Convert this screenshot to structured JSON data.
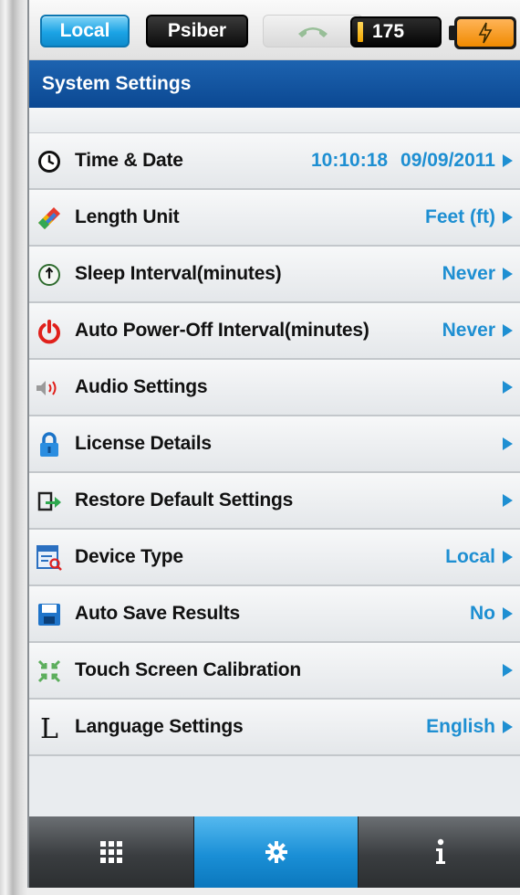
{
  "status_bar": {
    "mode_local": "Local",
    "mode_psiber": "Psiber",
    "count": "175"
  },
  "header": {
    "title": "System Settings"
  },
  "settings": [
    {
      "label": "Time & Date",
      "time": "10:10:18",
      "date": "09/09/2011",
      "icon": "clock-icon"
    },
    {
      "label": "Length Unit",
      "value": "Feet (ft)",
      "icon": "ruler-icon"
    },
    {
      "label": "Sleep Interval(minutes)",
      "value": "Never",
      "icon": "sleep-icon"
    },
    {
      "label": "Auto Power-Off Interval(minutes)",
      "value": "Never",
      "icon": "power-icon"
    },
    {
      "label": "Audio Settings",
      "value": "",
      "icon": "speaker-icon"
    },
    {
      "label": "License Details",
      "value": "",
      "icon": "lock-icon"
    },
    {
      "label": "Restore Default Settings",
      "value": "",
      "icon": "restore-icon"
    },
    {
      "label": "Device Type",
      "value": "Local",
      "icon": "device-type-icon"
    },
    {
      "label": "Auto Save Results",
      "value": "No",
      "icon": "save-icon"
    },
    {
      "label": "Touch Screen Calibration",
      "value": "",
      "icon": "calibration-icon"
    },
    {
      "label": "Language Settings",
      "value": "English",
      "icon": "language-icon"
    }
  ],
  "bottom_nav": [
    {
      "icon": "grid-icon",
      "active": false
    },
    {
      "icon": "gear-icon",
      "active": true
    },
    {
      "icon": "info-icon",
      "active": false
    }
  ],
  "colors": {
    "accent": "#1e8fd2",
    "header_blue": "#0b4892",
    "battery_orange": "#f08a00"
  }
}
